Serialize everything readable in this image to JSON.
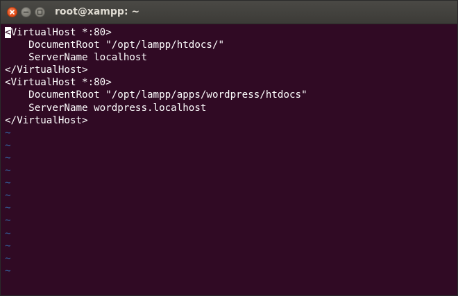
{
  "window": {
    "title": "root@xampp: ~"
  },
  "terminal": {
    "cursor_char": "<",
    "first_line_rest": "VirtualHost *:80>",
    "lines": [
      "    DocumentRoot \"/opt/lampp/htdocs/\"",
      "    ServerName localhost",
      "</VirtualHost>",
      "<VirtualHost *:80>",
      "    DocumentRoot \"/opt/lampp/apps/wordpress/htdocs\"",
      "    ServerName wordpress.localhost",
      "</VirtualHost>"
    ],
    "empty_line_marker": "~",
    "empty_line_count": 12,
    "colors": {
      "background": "#300a24",
      "text": "#ffffff",
      "tilde": "#3465a4"
    }
  }
}
